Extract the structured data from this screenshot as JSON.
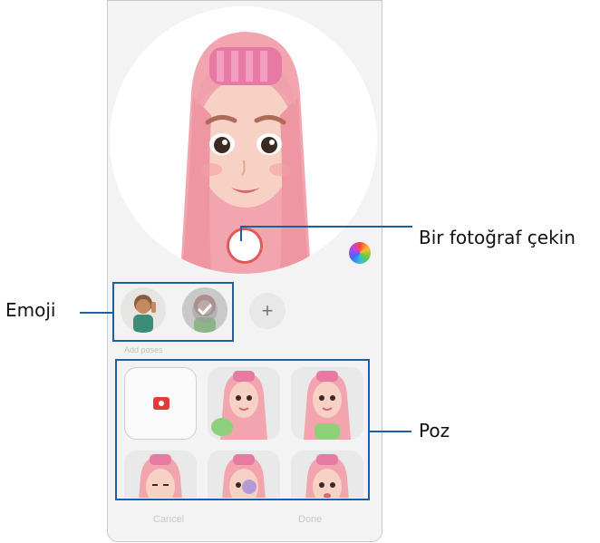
{
  "annotations": {
    "capture_label": "Bir fotoğraf çekin",
    "emoji_label": "Emoji",
    "pose_label": "Poz"
  },
  "emoji_row": {
    "add_symbol": "+"
  },
  "section": {
    "label": "Add poses"
  },
  "bottom_bar": {
    "cancel": "Cancel",
    "done": "Done"
  },
  "colors": {
    "callout": "#1a5fa8",
    "capture_ring": "#e05a5a",
    "camera_icon": "#e33b3b",
    "hair": "#f4a7b1"
  },
  "icons": {
    "capture": "shutter-icon",
    "palette": "color-palette-icon",
    "add": "plus-icon",
    "camera": "camera-icon"
  }
}
